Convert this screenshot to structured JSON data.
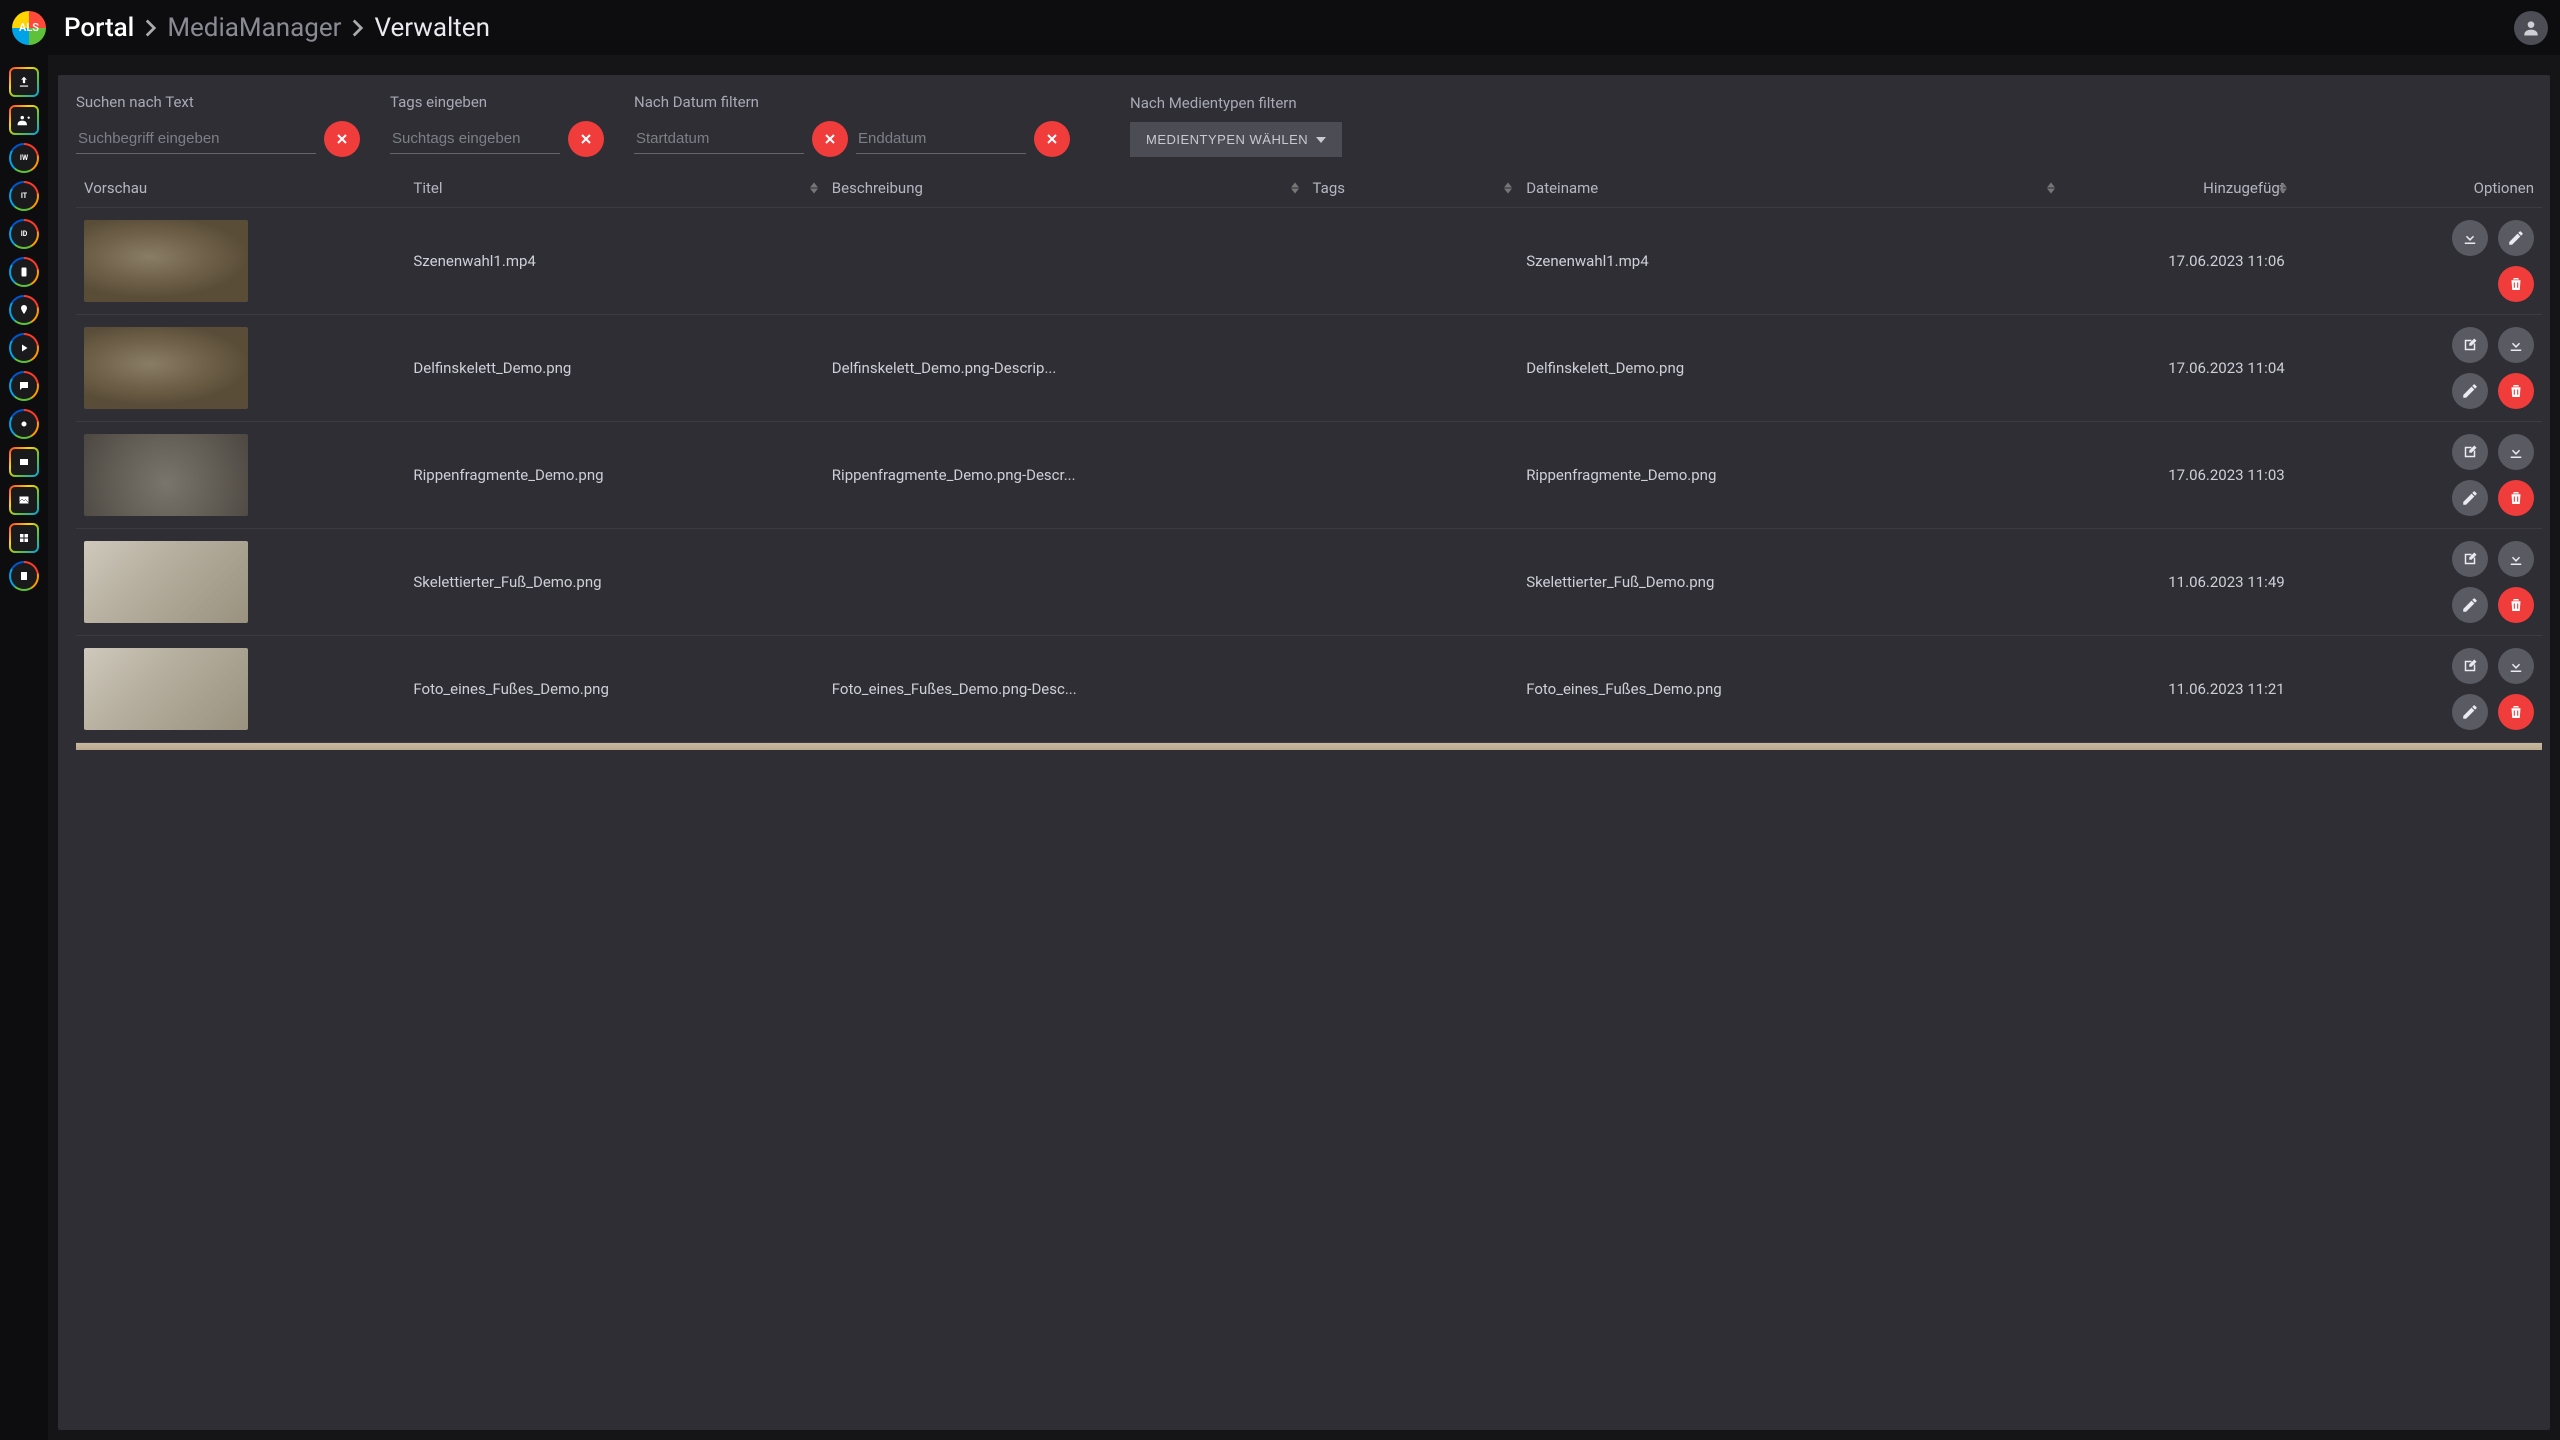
{
  "breadcrumb": {
    "root": "Portal",
    "mid": "MediaManager",
    "cur": "Verwalten"
  },
  "logo_text": "ALS",
  "filters": {
    "search_label": "Suchen nach Text",
    "search_placeholder": "Suchbegriff eingeben",
    "tags_label": "Tags eingeben",
    "tags_placeholder": "Suchtags eingeben",
    "date_label": "Nach Datum filtern",
    "date_start_placeholder": "Startdatum",
    "date_end_placeholder": "Enddatum",
    "mediatype_label": "Nach Medientypen filtern",
    "mediatype_button": "MEDIENTYPEN WÄHLEN"
  },
  "columns": {
    "thumb": "Vorschau",
    "title": "Titel",
    "desc": "Beschreibung",
    "tags": "Tags",
    "file": "Dateiname",
    "date": "Hinzugefügt",
    "opts": "Optionen"
  },
  "rail": {
    "upload": "upload",
    "invite": "invite",
    "iw": "IW",
    "it": "IT",
    "id": "ID",
    "phone": "phone",
    "pin": "pin",
    "play": "play",
    "chat": "chat",
    "star": "star",
    "film": "film",
    "picture": "picture",
    "pano": "pano",
    "misc": "misc"
  },
  "rows": [
    {
      "title": "Szenenwahl1.mp4",
      "desc": "",
      "tags": "",
      "file": "Szenenwahl1.mp4",
      "date": "17.06.2023 11:06",
      "opts": [
        "download",
        "edit",
        "trash"
      ]
    },
    {
      "title": "Delfinskelett_Demo.png",
      "desc": "Delfinskelett_Demo.png-Descrip...",
      "tags": "",
      "file": "Delfinskelett_Demo.png",
      "date": "17.06.2023 11:04",
      "opts": [
        "meta",
        "download",
        "edit",
        "trash"
      ]
    },
    {
      "title": "Rippenfragmente_Demo.png",
      "desc": "Rippenfragmente_Demo.png-Descr...",
      "tags": "",
      "file": "Rippenfragmente_Demo.png",
      "date": "17.06.2023 11:03",
      "opts": [
        "meta",
        "download",
        "edit",
        "trash"
      ]
    },
    {
      "title": "Skelettierter_Fuß_Demo.png",
      "desc": "",
      "tags": "",
      "file": "Skelettierter_Fuß_Demo.png",
      "date": "11.06.2023 11:49",
      "opts": [
        "meta",
        "download",
        "edit",
        "trash"
      ]
    },
    {
      "title": "Foto_eines_Fußes_Demo.png",
      "desc": "Foto_eines_Fußes_Demo.png-Desc...",
      "tags": "",
      "file": "Foto_eines_Fußes_Demo.png",
      "date": "11.06.2023 11:21",
      "opts": [
        "meta",
        "download",
        "edit",
        "trash"
      ]
    }
  ],
  "icons": {
    "download": "download-icon",
    "edit": "pencil-icon",
    "trash": "trash-icon",
    "meta": "edit-square-icon"
  }
}
